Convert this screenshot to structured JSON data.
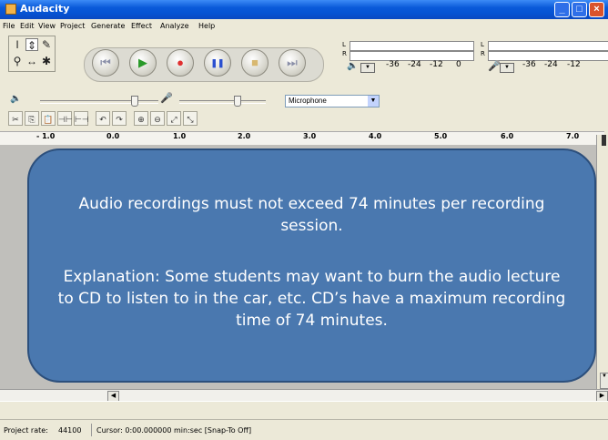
{
  "window": {
    "title": "Audacity",
    "min_label": "_",
    "max_label": "□",
    "close_label": "×"
  },
  "menu": [
    "File",
    "Edit",
    "View",
    "Project",
    "Generate",
    "Effect",
    "Analyze",
    "Help"
  ],
  "tools": {
    "select": "I",
    "envelope": "⇕",
    "draw": "✎",
    "zoom": "⚲",
    "timeshift": "↔",
    "multi": "✱"
  },
  "transport": {
    "rewind": "⏮",
    "play": "▶",
    "record": "●",
    "pause": "❚❚",
    "stop": "■",
    "ffwd": "⏭"
  },
  "meters": {
    "out_L": "L",
    "out_R": "R",
    "in_L": "L",
    "in_R": "R",
    "scale_out": [
      "-36",
      "-24",
      "-12",
      "0"
    ],
    "scale_in": [
      "-36",
      "-24",
      "-12"
    ]
  },
  "mixer": {
    "input_source": "Microphone"
  },
  "ruler": [
    "- 1.0",
    "0.0",
    "1.0",
    "2.0",
    "3.0",
    "4.0",
    "5.0",
    "6.0",
    "7.0"
  ],
  "status": {
    "project_rate_label": "Project rate:",
    "project_rate_value": "44100",
    "cursor_text": "Cursor: 0:00.000000 min:sec  [Snap-To Off]"
  },
  "callout": {
    "line1": "Audio recordings must not exceed 74 minutes per recording session.",
    "line2": "Explanation: Some students may want to burn the audio lecture to CD to listen to in the car, etc. CD’s have a maximum recording time of 74 minutes."
  },
  "colors": {
    "callout_fill": "#4a78af",
    "titlebar": "#0a5ad9",
    "record_red": "#e03030",
    "play_green": "#2a9a2a",
    "pause_blue": "#2a4fd0"
  }
}
